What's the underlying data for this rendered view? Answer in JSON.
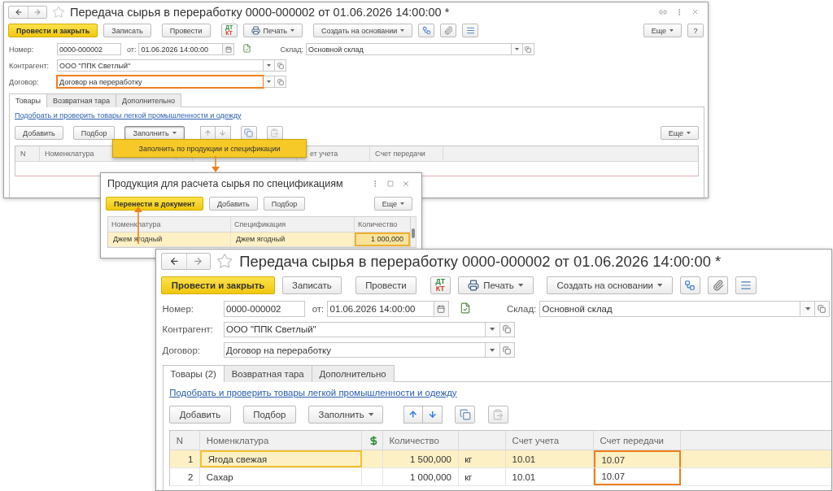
{
  "back_form": {
    "title": "Передача сырья в переработку 0000-000002 от 01.06.2026 14:00:00 *",
    "window_controls": true,
    "toolbar": [
      {
        "kind": "primary",
        "label": "Провести и закрыть"
      },
      {
        "kind": "button",
        "label": "Записать"
      },
      {
        "kind": "button",
        "label": "Провести"
      },
      {
        "kind": "dtkt",
        "labels": [
          "ДТ",
          "КТ"
        ]
      },
      {
        "kind": "print",
        "label": "Печать"
      },
      {
        "kind": "menu",
        "label": "Создать на основании"
      },
      {
        "kind": "icon"
      },
      {
        "kind": "icon"
      },
      {
        "kind": "icon"
      }
    ],
    "more_button": "Еще",
    "help_button": "?",
    "fields": {
      "number": {
        "label": "Номер:",
        "value": "0000-000002"
      },
      "date": {
        "label": "от:",
        "value": "01.06.2026 14:00:00"
      },
      "warehouse": {
        "label": "Склад:",
        "value": "Основной склад"
      },
      "counterparty": {
        "label": "Контрагент:",
        "value": "ООО \"ППК Светлый\""
      },
      "contract": {
        "label": "Договор:",
        "value": "Договор на переработку",
        "highlighted": true
      }
    },
    "tabs": [
      {
        "label": "Товары",
        "selected": true
      },
      {
        "label": "Возвратная тара",
        "selected": false
      },
      {
        "label": "Дополнительно",
        "selected": false
      }
    ],
    "link": "Подобрать и проверить товары легкой промышленности и одежду",
    "table_toolbar": [
      {
        "kind": "button",
        "label": "Добавить"
      },
      {
        "kind": "button",
        "label": "Подбор"
      },
      {
        "kind": "menu",
        "label": "Заполнить",
        "pressed": true
      },
      {
        "kind": "arrows",
        "disabled": true
      },
      {
        "kind": "icon"
      },
      {
        "kind": "icon",
        "disabled": true
      }
    ],
    "table_more": "Еще",
    "fill_menu": [
      {
        "label": "Заполнить по продукции и спецификации",
        "selected": true
      }
    ],
    "columns": [
      {
        "label": "N"
      },
      {
        "label": "Номенклатура"
      },
      {
        "label": "ет учета"
      },
      {
        "label": "Счет передачи"
      }
    ]
  },
  "dialog": {
    "title": "Продукция для расчета сырья по спецификациям",
    "buttons": [
      {
        "kind": "primary",
        "label": "Перенести в документ"
      },
      {
        "kind": "button",
        "label": "Добавить"
      },
      {
        "kind": "button",
        "label": "Подбор"
      }
    ],
    "more_button": "Еще",
    "columns": [
      "Номенклатура",
      "Спецификация",
      "Количество"
    ],
    "rows": [
      {
        "product": "Джем ягодный",
        "specification": "Джем ягодный",
        "quantity": "1 000,000",
        "selected": true
      }
    ]
  },
  "front_form": {
    "title": "Передача сырья в переработку 0000-000002 от 01.06.2026 14:00:00 *",
    "toolbar": [
      {
        "kind": "primary",
        "label": "Провести и закрыть"
      },
      {
        "kind": "button",
        "label": "Записать"
      },
      {
        "kind": "button",
        "label": "Провести"
      },
      {
        "kind": "dtkt",
        "labels": [
          "ДТ",
          "КТ"
        ]
      },
      {
        "kind": "print",
        "label": "Печать"
      },
      {
        "kind": "menu",
        "label": "Создать на основании"
      },
      {
        "kind": "icon"
      },
      {
        "kind": "icon"
      },
      {
        "kind": "icon"
      }
    ],
    "fields": {
      "number": {
        "label": "Номер:",
        "value": "0000-000002"
      },
      "date": {
        "label": "от:",
        "value": "01.06.2026 14:00:00"
      },
      "warehouse": {
        "label": "Склад:",
        "value": "Основной склад"
      },
      "counterparty": {
        "label": "Контрагент:",
        "value": "ООО \"ППК Светлый\""
      },
      "contract": {
        "label": "Договор:",
        "value": "Договор на переработку",
        "highlighted": false
      }
    },
    "tabs": [
      {
        "label": "Товары (2)",
        "selected": true
      },
      {
        "label": "Возвратная тара",
        "selected": false
      },
      {
        "label": "Дополнительно",
        "selected": false
      }
    ],
    "link": "Подобрать и проверить товары легкой промышленности и одежду",
    "table_toolbar": [
      {
        "kind": "button",
        "label": "Добавить"
      },
      {
        "kind": "button",
        "label": "Подбор"
      },
      {
        "kind": "menu",
        "label": "Заполнить",
        "pressed": false
      },
      {
        "kind": "arrows",
        "disabled": false
      },
      {
        "kind": "icon"
      },
      {
        "kind": "icon",
        "disabled": true
      }
    ],
    "columns": [
      {
        "label": "N"
      },
      {
        "label": "Номенклатура"
      },
      {
        "label": "Количество"
      },
      {
        "label": "Счет учета"
      },
      {
        "label": "Счет передачи",
        "highlighted": true
      }
    ],
    "rows": [
      {
        "n": "1",
        "name": "Ягода свежая",
        "quantity": "1 500,000",
        "unit": "кг",
        "account": "10.01",
        "transfer_account": "10.07",
        "selected": true
      },
      {
        "n": "2",
        "name": "Сахар",
        "quantity": "1 000,000",
        "unit": "кг",
        "account": "10.01",
        "transfer_account": "10.07",
        "selected": false
      }
    ]
  }
}
